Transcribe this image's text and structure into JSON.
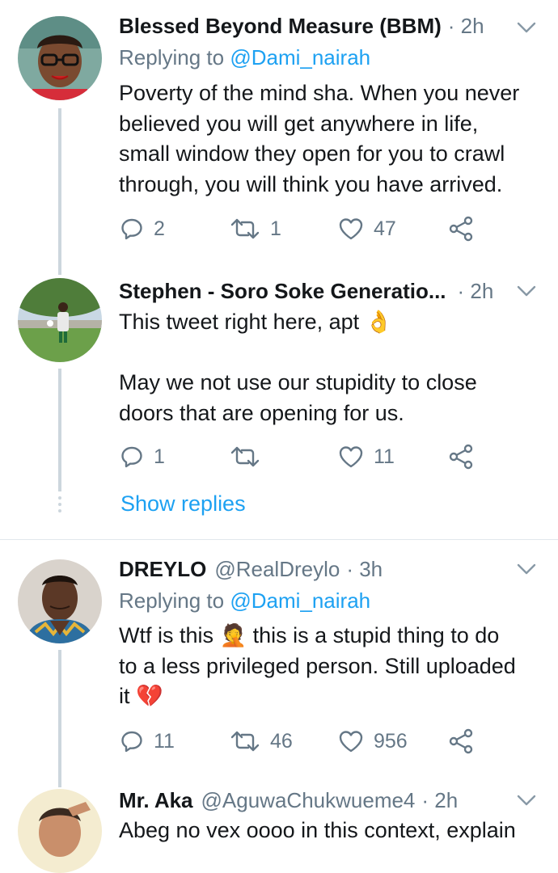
{
  "tweets": [
    {
      "name": "Blessed Beyond Measure (BBM)",
      "handle": "",
      "time": "· 2h",
      "replying_prefix": "Replying to ",
      "replying_to": "@Dami_nairah",
      "lines": [
        "Poverty of the mind sha. When you never",
        "believed you will get anywhere in life,",
        "small window they open for you to crawl",
        "through, you will think you have arrived."
      ],
      "replies": "2",
      "retweets": "1",
      "likes": "47"
    },
    {
      "name": "Stephen - Soro Soke Generatio...",
      "handle": "",
      "time": "· 2h",
      "lines": [
        "This tweet right here, apt 👌",
        "",
        "May we not use our stupidity to close",
        "doors that are opening for us."
      ],
      "replies": "1",
      "retweets": "",
      "likes": "11",
      "show_replies": "Show replies"
    },
    {
      "name": "DREYLO",
      "handle": "@RealDreylo",
      "time": "· 3h",
      "replying_prefix": "Replying to ",
      "replying_to": "@Dami_nairah",
      "lines": [
        "Wtf is this 🤦 this is a stupid thing to do",
        "to a less privileged person. Still uploaded",
        "it 💔"
      ],
      "replies": "11",
      "retweets": "46",
      "likes": "956"
    },
    {
      "name": "Mr. Aka",
      "handle": "@AguwaChukwueme4",
      "time": "· 2h",
      "lines": [
        "Abeg no vex oooo in this context, explain"
      ]
    }
  ],
  "colors": {
    "accent": "#1da1f2",
    "muted": "#657786",
    "text": "#14171a",
    "line": "#ccd6dd"
  },
  "icons": [
    "reply-icon",
    "retweet-icon",
    "like-icon",
    "share-icon",
    "chevron-down-icon"
  ]
}
